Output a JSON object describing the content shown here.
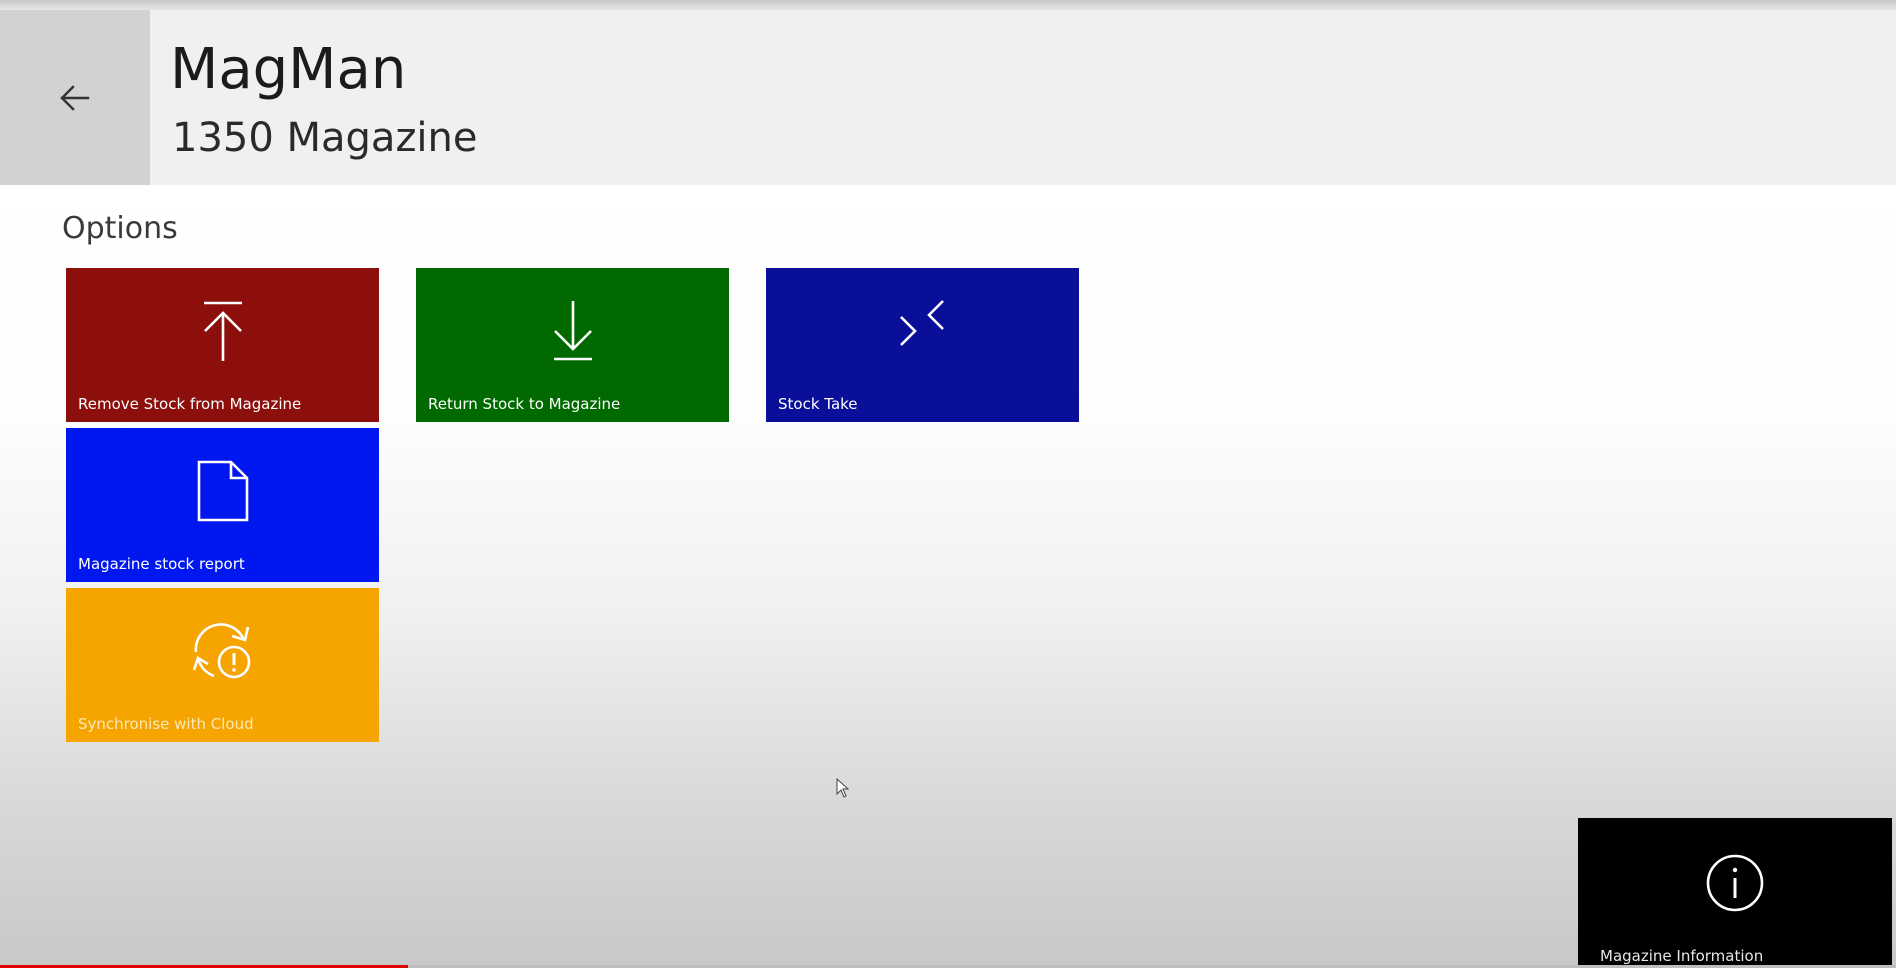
{
  "app": {
    "title": "MagMan",
    "subtitle": "1350 Magazine"
  },
  "header": {
    "back_icon": "arrow-left-icon"
  },
  "options": {
    "title": "Options",
    "tiles": [
      {
        "label": "Remove Stock from Magazine",
        "icon": "upload-icon",
        "color": "#8c0f0b"
      },
      {
        "label": "Return Stock to Magazine",
        "icon": "download-icon",
        "color": "#006a00"
      },
      {
        "label": "Stock Take",
        "icon": "collapse-arrows-icon",
        "color": "#0a0f99"
      },
      {
        "label": "Magazine stock report",
        "icon": "document-icon",
        "color": "#0017f0"
      },
      {
        "label": "Synchronise with Cloud",
        "icon": "sync-warning-icon",
        "color": "#f5a400"
      }
    ]
  },
  "info_tile": {
    "label": "Magazine Information",
    "icon": "info-icon",
    "color": "#000000"
  },
  "video_progress": {
    "fraction": 0.215
  }
}
